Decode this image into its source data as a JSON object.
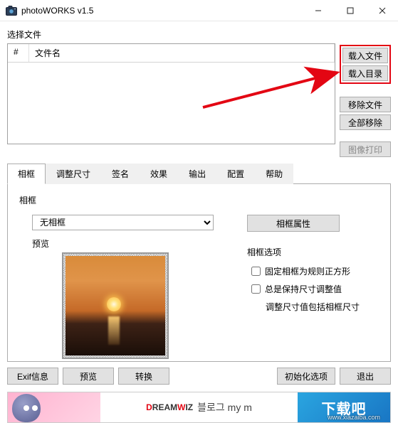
{
  "window": {
    "title": "photoWORKS v1.5"
  },
  "toolbar": {
    "select_file_label": "选择文件"
  },
  "filelist": {
    "col_hash": "#",
    "col_name": "文件名"
  },
  "sidebuttons": {
    "load_file": "载入文件",
    "load_dir": "载入目录",
    "remove_file": "移除文件",
    "remove_all": "全部移除",
    "image_print": "图像打印"
  },
  "tabs": {
    "frame": "相框",
    "resize": "调整尺寸",
    "signature": "签名",
    "effect": "效果",
    "output": "输出",
    "config": "配置",
    "help": "帮助"
  },
  "frame_tab": {
    "group_title": "相框",
    "combo_value": "无相框",
    "preview_label": "预览",
    "frame_props_btn": "相框属性",
    "options_title": "相框选项",
    "chk_fixed_square": "固定相框为规则正方形",
    "chk_keep_size": "总是保持尺寸调整值",
    "keep_size_note": "调整尺寸值包括相框尺寸"
  },
  "bottom": {
    "exif": "Exif信息",
    "preview": "预览",
    "convert": "转换",
    "init_options": "初始化选项",
    "exit": "退出"
  },
  "ad": {
    "brand": "DreamWiz",
    "text": "블로그 my m",
    "right": "下载吧",
    "watermark": "www.xiazaiba.com"
  }
}
